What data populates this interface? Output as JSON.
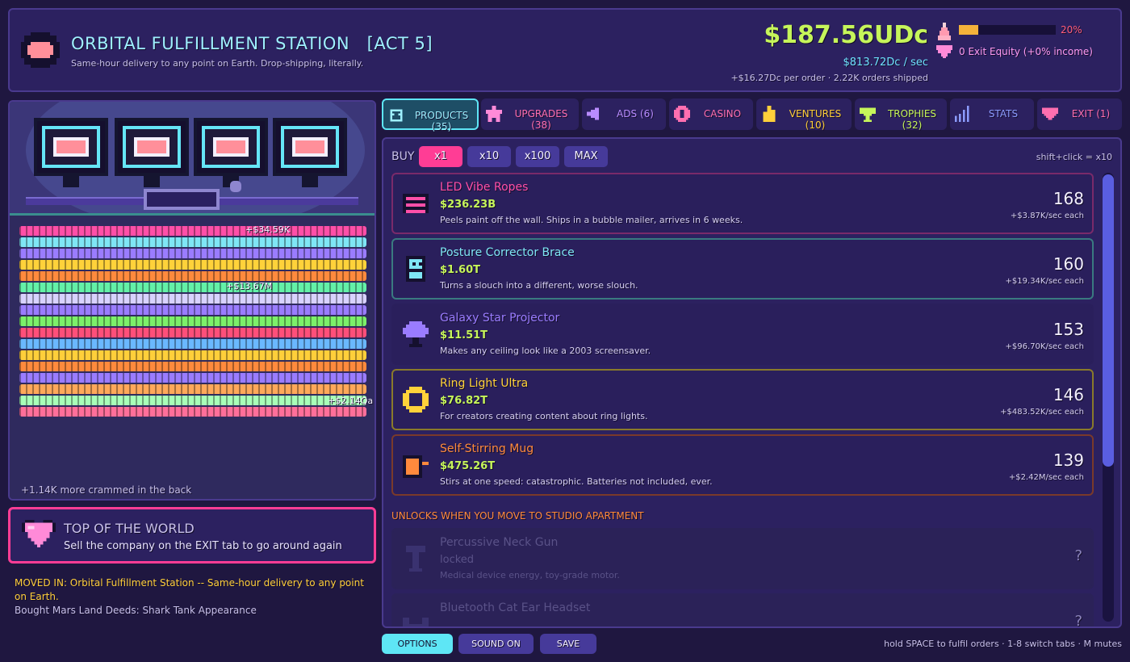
{
  "header": {
    "title": "ORBITAL FULFILLMENT STATION   [ACT 5]",
    "subtitle": "Same-hour delivery to any point on Earth. Drop-shipping, literally.",
    "money": "$187.56UDc",
    "rate": "$813.72Dc / sec",
    "per_order": "+$16.27Dc per order  ·  2.22K orders shipped",
    "progress_fraction": 0.2,
    "progress_label": "20%",
    "exit_equity": "0 Exit Equity  (+0% income)"
  },
  "scene": {
    "floats": [
      "+$34.59K",
      "+$13.67M",
      "+$2.14Qa"
    ],
    "crammed_text": "+1.14K more crammed in the back"
  },
  "milestone": {
    "title": "TOP OF THE WORLD",
    "desc": "Sell the company on the EXIT tab to go around again"
  },
  "log": {
    "line1": "MOVED IN: Orbital Fulfillment Station -- Same-hour delivery to any point on Earth.",
    "line2": "Bought Mars Land Deeds: Shark Tank Appearance"
  },
  "tabs": [
    {
      "label": "PRODUCTS (35)",
      "icon": "box-icon",
      "color": "#9ff0ff"
    },
    {
      "label": "UPGRADES (38)",
      "icon": "star-icon",
      "color": "#ff6fb0"
    },
    {
      "label": "ADS (6)",
      "icon": "megaphone-icon",
      "color": "#b98cff"
    },
    {
      "label": "CASINO",
      "icon": "chip-icon",
      "color": "#ff6fb0"
    },
    {
      "label": "VENTURES (10)",
      "icon": "building-icon",
      "color": "#ffcf3a"
    },
    {
      "label": "TROPHIES (32)",
      "icon": "trophy-icon",
      "color": "#c6f55a"
    },
    {
      "label": "STATS",
      "icon": "bars-icon",
      "color": "#8c9cff"
    },
    {
      "label": "EXIT (1)",
      "icon": "heart-icon",
      "color": "#ff6fb0"
    }
  ],
  "buy": {
    "label": "BUY",
    "options": [
      "x1",
      "x10",
      "x100",
      "MAX"
    ],
    "selected": "x1",
    "hint": "shift+click = x10"
  },
  "products": [
    {
      "name": "LED Vibe Ropes",
      "price": "$236.23B",
      "desc": "Peels paint off the wall. Ships in a bubble mailer, arrives in 6 weeks.",
      "count": "168",
      "each": "+$3.87K/sec each",
      "color": "#ff4fa8",
      "border": "#7a2a6a",
      "icon": "led-rope-icon"
    },
    {
      "name": "Posture Corrector Brace",
      "price": "$1.60T",
      "desc": "Turns a slouch into a different, worse slouch.",
      "count": "160",
      "each": "+$19.34K/sec each",
      "color": "#7fe6f5",
      "border": "#3a7a80",
      "icon": "brace-icon"
    },
    {
      "name": "Galaxy Star Projector",
      "price": "$11.51T",
      "desc": "Makes any ceiling look like a 2003 screensaver.",
      "count": "153",
      "each": "+$96.70K/sec each",
      "color": "#9a7cff",
      "border": "#2a1f5c",
      "icon": "projector-icon"
    },
    {
      "name": "Ring Light Ultra",
      "price": "$76.82T",
      "desc": "For creators creating content about ring lights.",
      "count": "146",
      "each": "+$483.52K/sec each",
      "color": "#ffd23a",
      "border": "#8a7a2a",
      "icon": "ring-light-icon"
    },
    {
      "name": "Self-Stirring Mug",
      "price": "$475.26T",
      "desc": "Stirs at one speed: catastrophic. Batteries not included, ever.",
      "count": "139",
      "each": "+$2.42M/sec each",
      "color": "#ff8a3d",
      "border": "#7a3a2a",
      "icon": "mug-icon"
    }
  ],
  "unlock_header": "UNLOCKS WHEN YOU MOVE TO STUDIO APARTMENT",
  "locked": [
    {
      "name": "Percussive Neck Gun",
      "status": "locked",
      "desc": "Medical device energy, toy-grade motor.",
      "q": "?",
      "icon": "neck-gun-icon"
    },
    {
      "name": "Bluetooth Cat Ear Headset",
      "status": "",
      "desc": "",
      "q": "?",
      "icon": "cat-ear-icon"
    }
  ],
  "footer": {
    "options": "OPTIONS",
    "sound": "SOUND ON",
    "save": "SAVE",
    "hint": "hold SPACE to fulfil orders  ·  1-8 switch tabs  ·  M mutes"
  }
}
